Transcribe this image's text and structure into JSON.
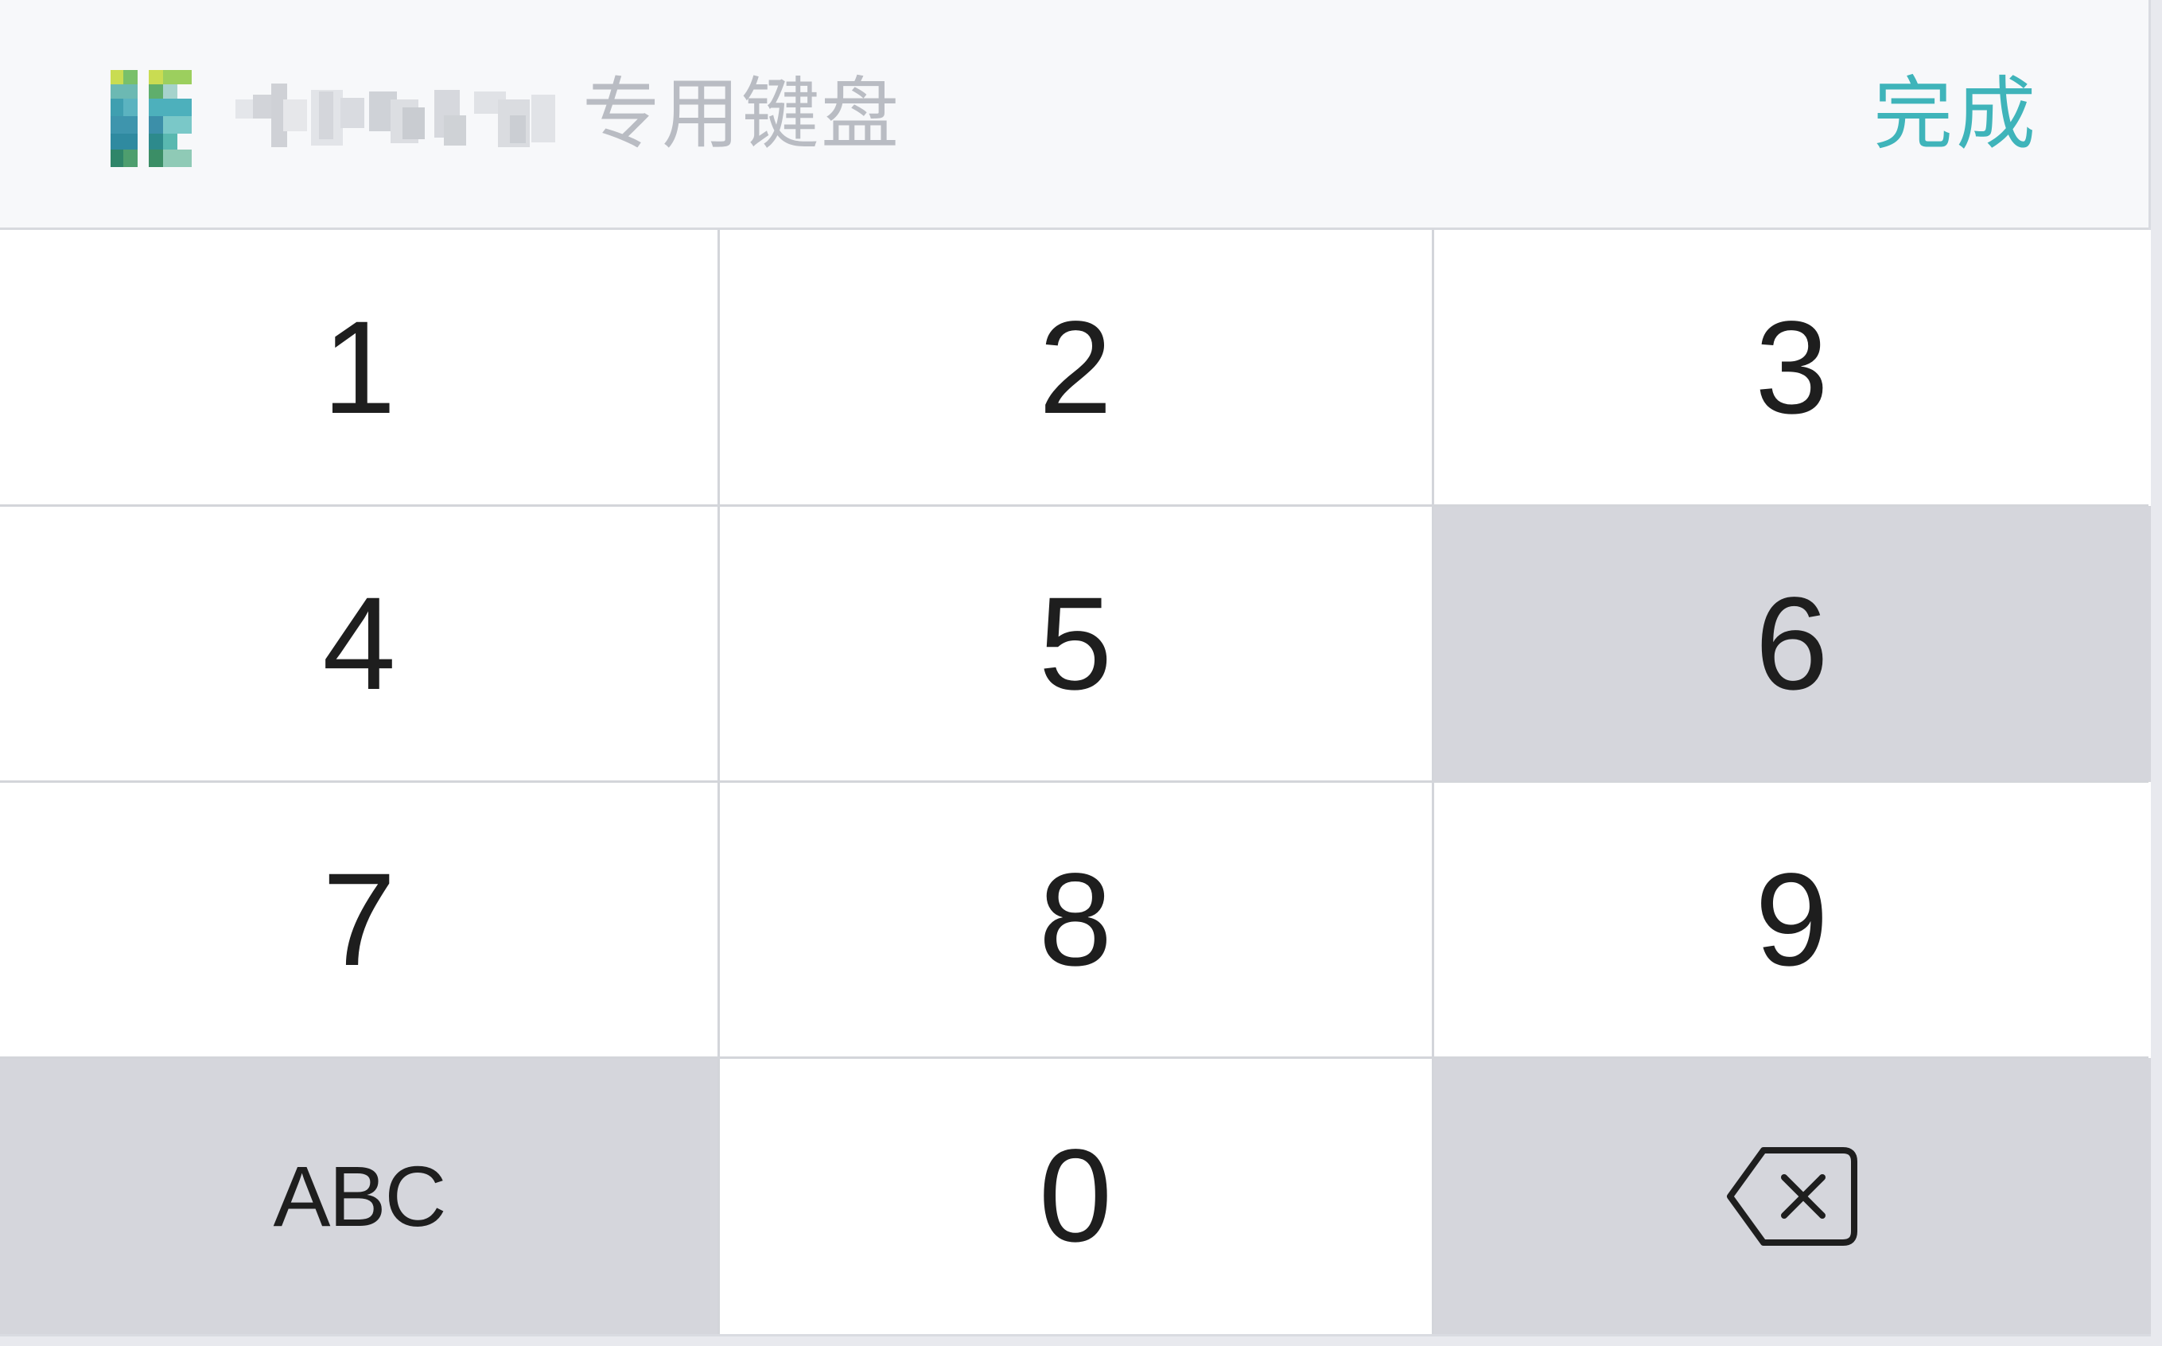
{
  "header": {
    "title_suffix": "专用键盘",
    "done_label": "完成"
  },
  "keys": {
    "k1": "1",
    "k2": "2",
    "k3": "3",
    "k4": "4",
    "k5": "5",
    "k6": "6",
    "k7": "7",
    "k8": "8",
    "k9": "9",
    "abc": "ABC",
    "k0": "0"
  },
  "colors": {
    "accent": "#3fb4ba",
    "key_pressed": "#d5d6dc",
    "key_normal": "#ffffff",
    "header_bg": "#f7f8fa"
  },
  "state": {
    "pressed_key": "6"
  }
}
